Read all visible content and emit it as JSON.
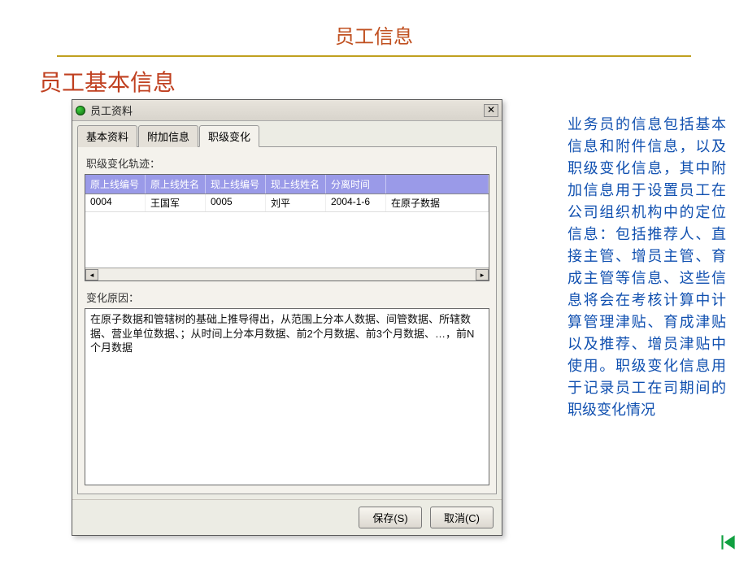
{
  "page": {
    "title": "员工信息",
    "section_title": "员工基本信息"
  },
  "dialog": {
    "title": "员工资料",
    "tabs": [
      "基本资料",
      "附加信息",
      "职级变化"
    ],
    "active_tab": 2,
    "track_label": "职级变化轨迹：",
    "grid": {
      "headers": [
        "原上线编号",
        "原上线姓名",
        "现上线编号",
        "现上线姓名",
        "分离时间",
        ""
      ],
      "rows": [
        [
          "0004",
          "王国军",
          "0005",
          "刘平",
          "2004-1-6",
          "在原子数据"
        ]
      ]
    },
    "reason_label": "变化原因：",
    "reason_text": "在原子数据和管辖树的基础上推导得出，从范围上分本人数据、间管数据、所辖数据、营业单位数据、；从时间上分本月数据、前2个月数据、前3个月数据、…，前N个月数据",
    "buttons": {
      "save": "保存(S)",
      "cancel": "取消(C)"
    }
  },
  "side_text": "业务员的信息包括基本信息和附件信息，以及职级变化信息，其中附加信息用于设置员工在公司组织机构中的定位信息：包括推荐人、直接主管、增员主管、育成主管等信息、这些信息将会在考核计算中计算管理津贴、育成津贴以及推荐、增员津贴中使用。职级变化信息用于记录员工在司期间的职级变化情况",
  "colors": {
    "title": "#c05020",
    "underline": "#c0a020",
    "side_text": "#1050b0",
    "grid_header_bg": "#9a9ae8"
  }
}
